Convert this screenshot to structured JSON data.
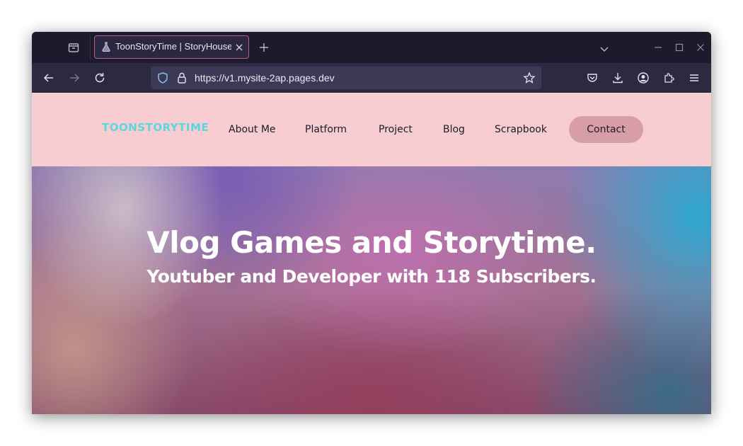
{
  "browser": {
    "tab": {
      "title": "ToonStoryTime | StoryHouse"
    },
    "address": {
      "url": "https://v1.mysite-2ap.pages.dev"
    }
  },
  "site": {
    "logo": "TOONSTORYTIME",
    "nav": {
      "about": "About Me",
      "platform": "Platform",
      "project": "Project",
      "blog": "Blog",
      "scrapbook": "Scrapbook",
      "contact": "Contact"
    },
    "hero": {
      "title": "Vlog Games and Storytime.",
      "subtitle": "Youtuber and Developer with 118 Subscribers."
    }
  },
  "colors": {
    "header_bg": "#f7cdd1",
    "logo": "#5ad6df",
    "contact_button": "#d69ea5",
    "tab_border": "#c05a86"
  }
}
